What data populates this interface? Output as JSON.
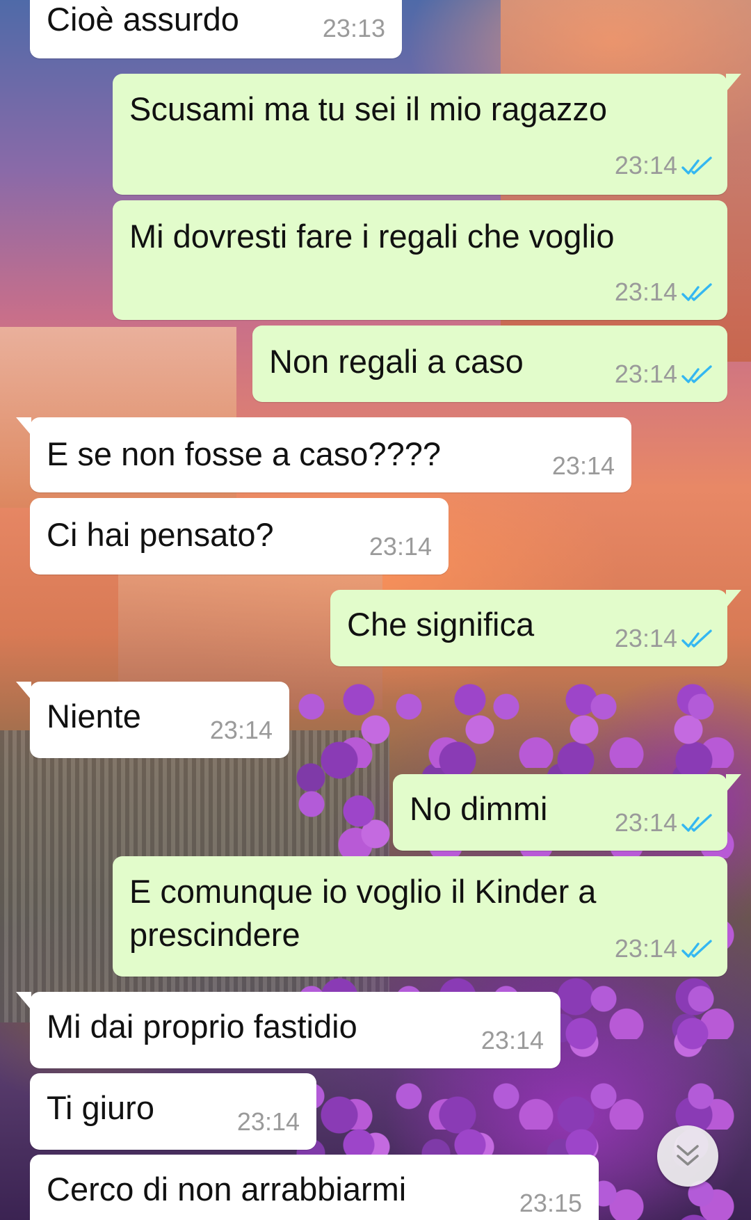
{
  "colors": {
    "incoming_bubble": "#ffffff",
    "outgoing_bubble": "#e2fccb",
    "read_ticks": "#34b7f1",
    "timestamp": "#9a9a9a"
  },
  "messages": [
    {
      "direction": "in",
      "text": "Cioè assurdo",
      "time": "23:13"
    },
    {
      "direction": "out",
      "text": "Scusami ma tu sei il mio ragazzo",
      "time": "23:14",
      "status": "read"
    },
    {
      "direction": "out",
      "text": "Mi dovresti fare i regali che voglio",
      "time": "23:14",
      "status": "read"
    },
    {
      "direction": "out",
      "text": "Non regali a caso",
      "time": "23:14",
      "status": "read"
    },
    {
      "direction": "in",
      "text": "E se non fosse a caso????",
      "time": "23:14"
    },
    {
      "direction": "in",
      "text": "Ci hai pensato?",
      "time": "23:14"
    },
    {
      "direction": "out",
      "text": "Che significa",
      "time": "23:14",
      "status": "read"
    },
    {
      "direction": "in",
      "text": "Niente",
      "time": "23:14"
    },
    {
      "direction": "out",
      "text": "No dimmi",
      "time": "23:14",
      "status": "read"
    },
    {
      "direction": "out",
      "text_line1": "E comunque io voglio il Kinder a",
      "text_line2": "prescindere",
      "time": "23:14",
      "status": "read"
    },
    {
      "direction": "in",
      "text": "Mi dai proprio fastidio",
      "time": "23:14"
    },
    {
      "direction": "in",
      "text": "Ti giuro",
      "time": "23:14"
    },
    {
      "direction": "in",
      "text": "Cerco di non arrabbiarmi",
      "time": "23:15"
    }
  ],
  "scroll_button_icon": "double-chevron-down-icon",
  "read_icon": "double-check-icon"
}
